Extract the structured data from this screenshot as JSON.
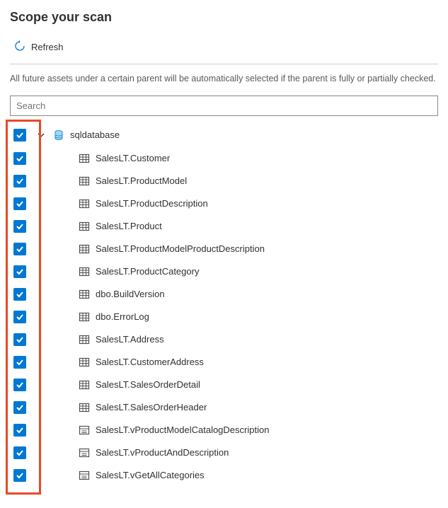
{
  "title": "Scope your scan",
  "toolbar": {
    "refresh_label": "Refresh"
  },
  "description": "All future assets under a certain parent will be automatically selected if the parent is fully or partially checked.",
  "search": {
    "placeholder": "Search"
  },
  "tree": {
    "root": {
      "label": "sqldatabase",
      "icon": "database",
      "checked": true
    },
    "items": [
      {
        "label": "SalesLT.Customer",
        "icon": "table",
        "checked": true
      },
      {
        "label": "SalesLT.ProductModel",
        "icon": "table",
        "checked": true
      },
      {
        "label": "SalesLT.ProductDescription",
        "icon": "table",
        "checked": true
      },
      {
        "label": "SalesLT.Product",
        "icon": "table",
        "checked": true
      },
      {
        "label": "SalesLT.ProductModelProductDescription",
        "icon": "table",
        "checked": true
      },
      {
        "label": "SalesLT.ProductCategory",
        "icon": "table",
        "checked": true
      },
      {
        "label": "dbo.BuildVersion",
        "icon": "table",
        "checked": true
      },
      {
        "label": "dbo.ErrorLog",
        "icon": "table",
        "checked": true
      },
      {
        "label": "SalesLT.Address",
        "icon": "table",
        "checked": true
      },
      {
        "label": "SalesLT.CustomerAddress",
        "icon": "table",
        "checked": true
      },
      {
        "label": "SalesLT.SalesOrderDetail",
        "icon": "table",
        "checked": true
      },
      {
        "label": "SalesLT.SalesOrderHeader",
        "icon": "table",
        "checked": true
      },
      {
        "label": "SalesLT.vProductModelCatalogDescription",
        "icon": "view",
        "checked": true
      },
      {
        "label": "SalesLT.vProductAndDescription",
        "icon": "view",
        "checked": true
      },
      {
        "label": "SalesLT.vGetAllCategories",
        "icon": "view",
        "checked": true
      }
    ]
  }
}
